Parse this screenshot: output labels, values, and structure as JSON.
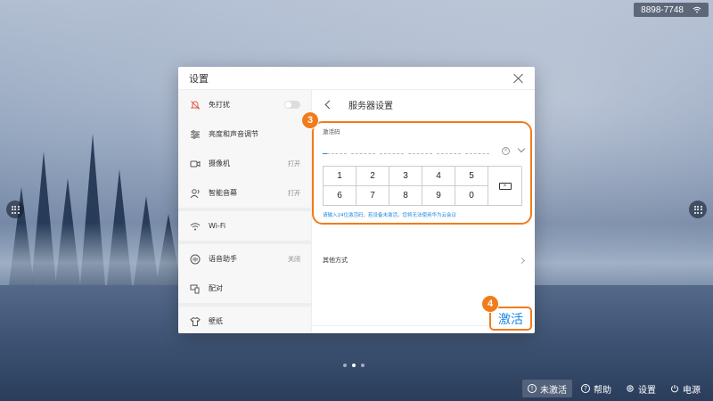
{
  "status": {
    "device_id": "8898-7748",
    "wifi_icon": "wifi-icon"
  },
  "dialog": {
    "title": "设置",
    "nav": [
      {
        "label": "免打扰",
        "icon": "bell-off-icon",
        "value": "",
        "toggle": true
      },
      {
        "label": "亮度和声音调节",
        "icon": "sliders-icon",
        "value": ""
      },
      {
        "label": "摄像机",
        "icon": "camera-icon",
        "value": "打开"
      },
      {
        "label": "智能音幕",
        "icon": "person-voice-icon",
        "value": "打开"
      },
      {
        "label": "Wi-Fi",
        "icon": "wifi-icon",
        "value": ""
      },
      {
        "label": "语音助手",
        "icon": "voice-assistant-icon",
        "value": "关闭"
      },
      {
        "label": "配对",
        "icon": "pairing-icon",
        "value": ""
      },
      {
        "label": "壁纸",
        "icon": "shirt-icon",
        "value": ""
      }
    ],
    "main": {
      "title": "服务器设置",
      "code_label": "激活码",
      "keys_row1": [
        "1",
        "2",
        "3",
        "4",
        "5"
      ],
      "keys_row2": [
        "6",
        "7",
        "8",
        "9",
        "0"
      ],
      "hint": "请输入24位激活码，若设备未激活，您将无法使用华为云会议",
      "other": "其他方式",
      "activate": "激活"
    }
  },
  "annotations": {
    "step3": "3",
    "step4": "4"
  },
  "bottombar": {
    "not_activated": "未激活",
    "help": "帮助",
    "settings": "设置",
    "power": "电源"
  },
  "colors": {
    "accent": "#1e88e5",
    "annotation": "#f07c1b"
  }
}
